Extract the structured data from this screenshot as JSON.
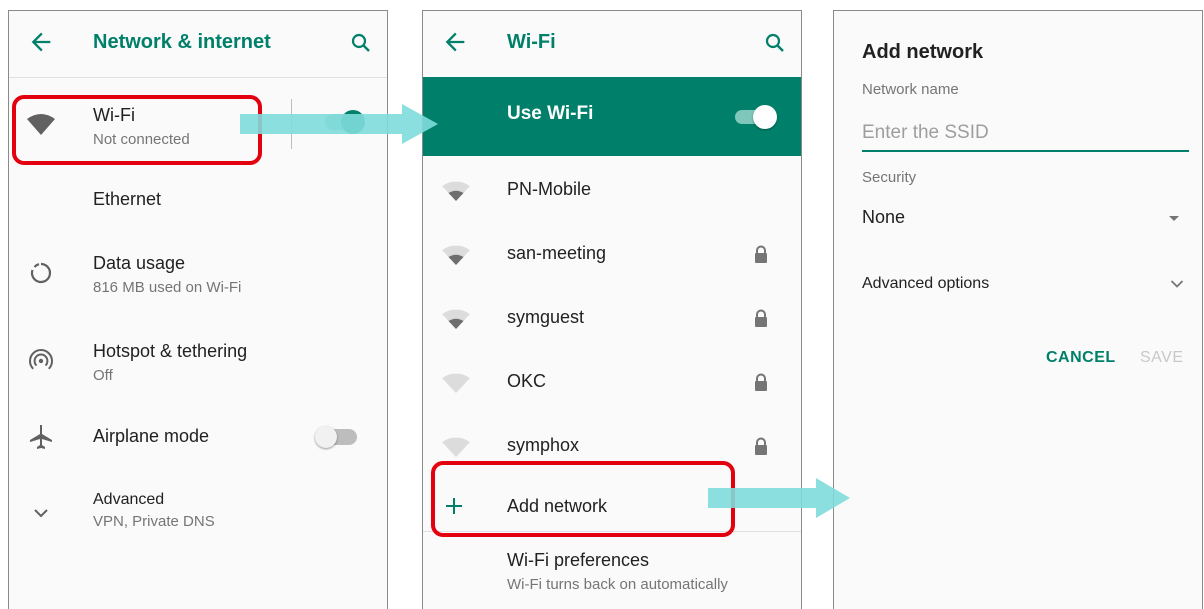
{
  "screen1": {
    "title": "Network & internet",
    "items": [
      {
        "label": "Wi-Fi",
        "sub": "Not connected"
      },
      {
        "label": "Ethernet"
      },
      {
        "label": "Data usage",
        "sub": "816 MB used on Wi-Fi"
      },
      {
        "label": "Hotspot & tethering",
        "sub": "Off"
      },
      {
        "label": "Airplane mode"
      },
      {
        "label": "Advanced",
        "sub": "VPN, Private DNS"
      }
    ]
  },
  "screen2": {
    "title": "Wi-Fi",
    "use_wifi": "Use Wi-Fi",
    "networks": [
      {
        "name": "PN-Mobile",
        "locked": false
      },
      {
        "name": "san-meeting",
        "locked": true
      },
      {
        "name": "symguest",
        "locked": true
      },
      {
        "name": "OKC",
        "locked": true
      },
      {
        "name": "symphox",
        "locked": true
      }
    ],
    "add_network": "Add network",
    "preferences": {
      "label": "Wi-Fi preferences",
      "sub": "Wi-Fi turns back on automatically"
    }
  },
  "screen3": {
    "title": "Add network",
    "network_name_label": "Network name",
    "ssid_placeholder": "Enter the SSID",
    "security_label": "Security",
    "security_value": "None",
    "advanced_options": "Advanced options",
    "cancel": "CANCEL",
    "save": "SAVE"
  },
  "colors": {
    "accent": "#00806a",
    "highlight": "#e3000f",
    "arrow": "#7fdcdc"
  }
}
